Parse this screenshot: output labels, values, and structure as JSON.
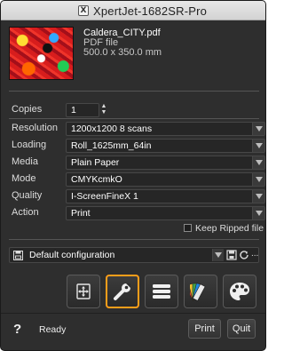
{
  "window": {
    "title": "XpertJet-1682SR-Pro"
  },
  "file": {
    "name": "Caldera_CITY.pdf",
    "type": "PDF file",
    "size": "500.0 x 350.0 mm"
  },
  "settings": {
    "copies_label": "Copies",
    "copies_value": "1",
    "rows": [
      {
        "label": "Resolution",
        "value": "1200x1200 8 scans"
      },
      {
        "label": "Loading",
        "value": "Roll_1625mm_64in"
      },
      {
        "label": "Media",
        "value": "Plain Paper"
      },
      {
        "label": "Mode",
        "value": "CMYKcmkO"
      },
      {
        "label": "Quality",
        "value": "I-ScreenFineX 1"
      },
      {
        "label": "Action",
        "value": "Print"
      }
    ],
    "keep_ripped_label": "Keep Ripped file",
    "keep_ripped_checked": false
  },
  "configuration": {
    "value": "Default configuration",
    "more_label": "..."
  },
  "toolbar": {
    "active_tool": "wrench-tool",
    "tools": [
      "move-tool",
      "wrench-tool",
      "list-tool",
      "swatch-tool",
      "palette-tool"
    ],
    "accent_color": "#ff9e1a"
  },
  "footer": {
    "help_label": "?",
    "status": "Ready",
    "print_label": "Print",
    "quit_label": "Quit"
  }
}
